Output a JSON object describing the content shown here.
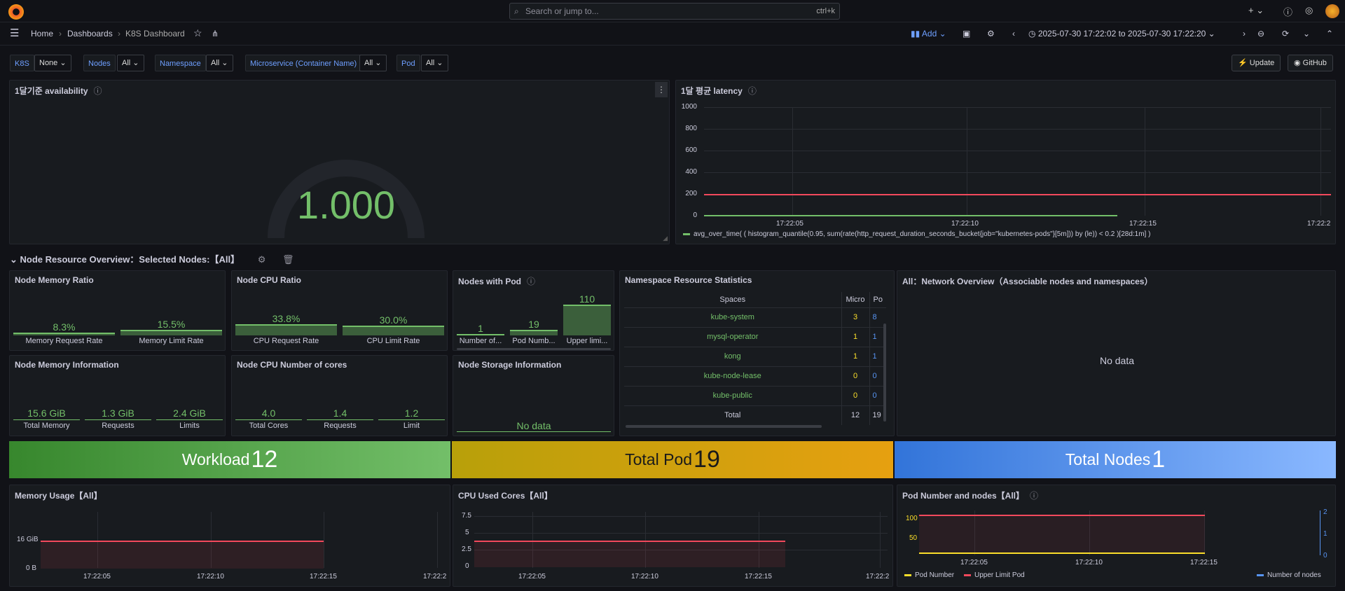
{
  "topbar": {
    "search_placeholder": "Search or jump to...",
    "search_shortcut": "ctrl+k"
  },
  "nav": {
    "home": "Home",
    "dashboards": "Dashboards",
    "current": "K8S Dashboard",
    "add": "Add",
    "time_range": "2025-07-30 17:22:02 to 2025-07-30 17:22:20"
  },
  "variables": [
    {
      "label": "K8S",
      "value": "None"
    },
    {
      "label": "Nodes",
      "value": "All"
    },
    {
      "label": "Namespace",
      "value": "All"
    },
    {
      "label": "Microservice (Container Name)",
      "value": "All"
    },
    {
      "label": "Pod",
      "value": "All"
    }
  ],
  "buttons": {
    "update": "Update",
    "github": "GitHub"
  },
  "availability": {
    "title": "1달기준 availability",
    "value": "1.000"
  },
  "latency": {
    "title": "1달 평균 latency",
    "yticks": [
      "1000",
      "800",
      "600",
      "400",
      "200",
      "0"
    ],
    "xticks": [
      "17:22:05",
      "17:22:10",
      "17:22:15",
      "17:22:2"
    ],
    "legend": "avg_over_time( ( histogram_quantile(0.95, sum(rate(http_request_duration_seconds_bucket{job=\"kubernetes-pods\"}[5m])) by (le)) < 0.2 )[28d:1m] )"
  },
  "section": {
    "title": "Node Resource Overview：Selected Nodes:【All】"
  },
  "mem_ratio": {
    "title": "Node Memory Ratio",
    "items": [
      {
        "value": "8.3%",
        "label": "Memory Request Rate"
      },
      {
        "value": "15.5%",
        "label": "Memory Limit Rate"
      }
    ]
  },
  "cpu_ratio": {
    "title": "Node CPU Ratio",
    "items": [
      {
        "value": "33.8%",
        "label": "CPU Request Rate"
      },
      {
        "value": "30.0%",
        "label": "CPU Limit Rate"
      }
    ]
  },
  "nodes_pod": {
    "title": "Nodes with Pod",
    "items": [
      {
        "value": "1",
        "label": "Number of..."
      },
      {
        "value": "19",
        "label": "Pod Numb..."
      },
      {
        "value": "110",
        "label": "Upper limi..."
      }
    ]
  },
  "mem_info": {
    "title": "Node Memory Information",
    "items": [
      {
        "value": "15.6 GiB",
        "label": "Total Memory"
      },
      {
        "value": "1.3 GiB",
        "label": "Requests"
      },
      {
        "value": "2.4 GiB",
        "label": "Limits"
      }
    ]
  },
  "cpu_cores": {
    "title": "Node CPU Number of cores",
    "items": [
      {
        "value": "4.0",
        "label": "Total Cores"
      },
      {
        "value": "1.4",
        "label": "Requests"
      },
      {
        "value": "1.2",
        "label": "Limit"
      }
    ]
  },
  "storage": {
    "title": "Node Storage Information",
    "nodata": "No data"
  },
  "ns_stats": {
    "title": "Namespace Resource Statistics",
    "headers": [
      "Spaces",
      "Micro",
      "Po"
    ],
    "rows": [
      [
        "kube-system",
        "3",
        "8"
      ],
      [
        "mysql-operator",
        "1",
        "1"
      ],
      [
        "kong",
        "1",
        "1"
      ],
      [
        "kube-node-lease",
        "0",
        "0"
      ],
      [
        "kube-public",
        "0",
        "0"
      ]
    ],
    "total": [
      "Total",
      "12",
      "19"
    ]
  },
  "network": {
    "title": "All：Network Overview（Associable nodes and namespaces）",
    "nodata": "No data"
  },
  "workload": {
    "label": "Workload",
    "value": "12"
  },
  "total_pod": {
    "label": "Total Pod",
    "value": "19"
  },
  "total_nodes": {
    "label": "Total Nodes",
    "value": "1"
  },
  "memory_usage": {
    "title": "Memory Usage【All】",
    "yticks": [
      "16 GiB",
      "0 B"
    ],
    "xticks": [
      "17:22:05",
      "17:22:10",
      "17:22:15",
      "17:22:2"
    ]
  },
  "cpu_used": {
    "title": "CPU Used Cores【All】",
    "yticks": [
      "7.5",
      "5",
      "2.5",
      "0"
    ],
    "xticks": [
      "17:22:05",
      "17:22:10",
      "17:22:15",
      "17:22:2"
    ]
  },
  "pod_nodes": {
    "title": "Pod Number and nodes【All】",
    "yticks_left": [
      "100",
      "50"
    ],
    "yticks_right": [
      "2",
      "1",
      "0"
    ],
    "xticks": [
      "17:22:05",
      "17:22:10",
      "17:22:15"
    ],
    "legend": [
      "Pod Number",
      "Upper Limit Pod",
      "Number of nodes"
    ]
  },
  "colors": {
    "green": "#73bf69",
    "red": "#f2495c",
    "yellow": "#fade2a",
    "blue": "#5794f2"
  }
}
